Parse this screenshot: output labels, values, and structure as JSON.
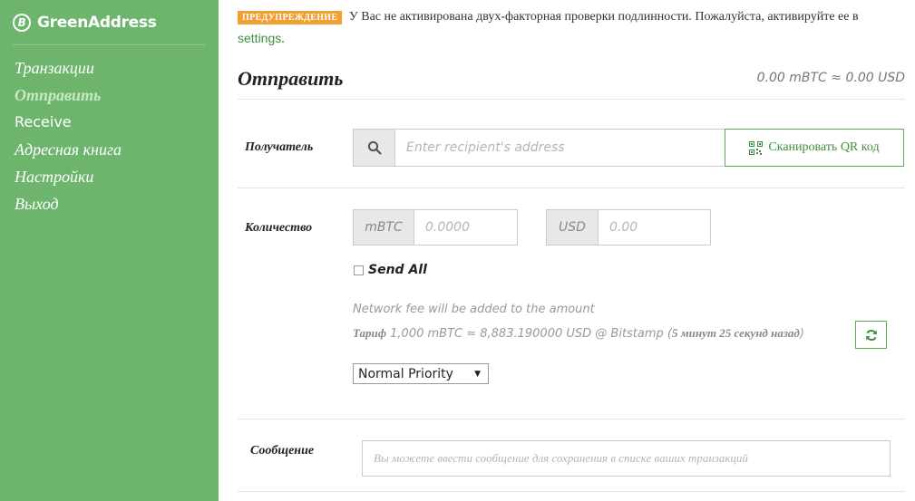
{
  "app": {
    "brand": "GreenAddress",
    "logo_glyph": "B"
  },
  "sidebar": {
    "items": [
      {
        "label": "Транзакции",
        "active": false
      },
      {
        "label": "Отправить",
        "active": true
      },
      {
        "label": "Receive",
        "active": false
      },
      {
        "label": "Адресная книга",
        "active": false
      },
      {
        "label": "Настройки",
        "active": false
      },
      {
        "label": "Выход",
        "active": false
      }
    ]
  },
  "warning": {
    "label": "ПРЕДУПРЕЖДЕНИЕ",
    "text": "У Вас не активирована двух-факторная проверки подлинности. Пожалуйста, активируйте ее в",
    "link_text": "settings",
    "suffix": "."
  },
  "page": {
    "title": "Отправить",
    "balance": "0.00 mBTC ≈ 0.00 USD"
  },
  "recipient": {
    "label": "Получатель",
    "placeholder": "Enter recipient's address",
    "search_icon": "search-icon",
    "scan_label": "Сканировать QR код",
    "scan_icon": "qr-code-icon"
  },
  "amount": {
    "label": "Количество",
    "btc_unit": "mBTC",
    "btc_placeholder": "0.0000",
    "usd_unit": "USD",
    "usd_placeholder": "0.00",
    "send_all_label": "Send All",
    "send_all_checked": false,
    "fee_note": "Network fee will be added to the amount",
    "rate_label": "Тариф",
    "rate_value": "1,000 mBTC ≈ 8,883.190000 USD @ Bitstamp (",
    "rate_time": "5 минут 25 секунд назад",
    "rate_close": ")",
    "priority_selected": "Normal Priority"
  },
  "message": {
    "label": "Сообщение",
    "placeholder": "Вы можете ввести сообщение для сохранения в списке ваших транзакций"
  },
  "colors": {
    "sidebar": "#6db56d",
    "accent": "#3c8f3c",
    "warning": "#f0a030"
  }
}
